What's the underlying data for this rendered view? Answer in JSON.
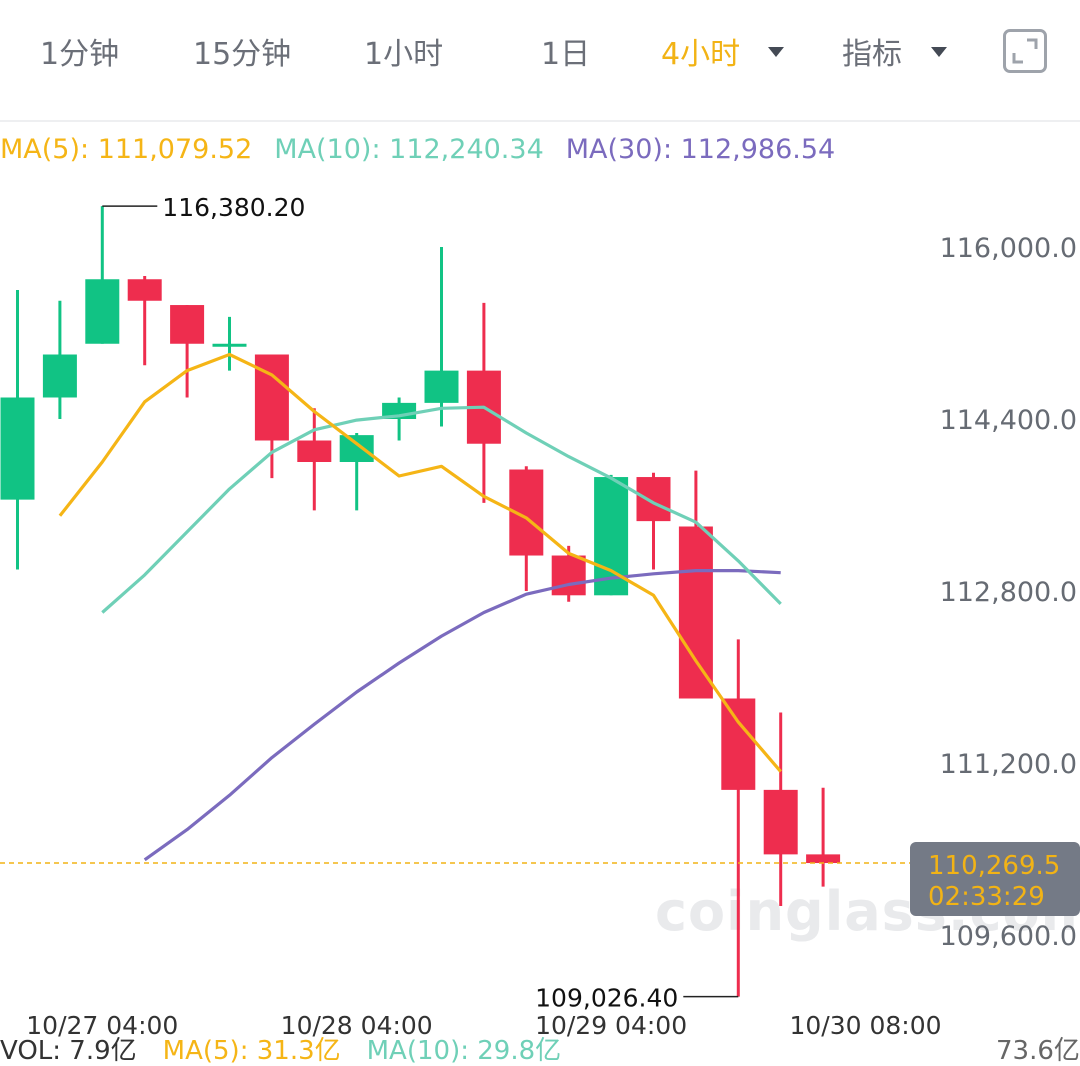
{
  "tabs": [
    {
      "label": "1分钟",
      "active": false
    },
    {
      "label": "15分钟",
      "active": false
    },
    {
      "label": "1小时",
      "active": false
    },
    {
      "label": "1日",
      "active": false
    },
    {
      "label": "4小时",
      "active": true
    },
    {
      "label": "指标",
      "active": false
    }
  ],
  "icons": {
    "fullscreen": "fullscreen-icon",
    "dropdown": "caret-down-icon"
  },
  "ma_legend": {
    "ma5": "MA(5): 111,079.52",
    "ma10": "MA(10): 112,240.34",
    "ma30": "MA(30): 112,986.54"
  },
  "colors": {
    "up": "#11c384",
    "down": "#ee2d4e",
    "ma5": "#f5b516",
    "ma10": "#6fd0b7",
    "ma30": "#7b6bbe",
    "accent": "#f2b315",
    "text": "#333333"
  },
  "current": {
    "price": "110,269.5",
    "countdown": "02:33:29"
  },
  "watermark": "coinglass.com",
  "volume_legend": {
    "vol": "VOL: 7.9亿",
    "ma5": "MA(5): 31.3亿",
    "ma10": "MA(10): 29.8亿",
    "right": "73.6亿"
  },
  "chart_data": {
    "type": "candlestick",
    "interval": "4小时",
    "ylim": [
      108800,
      116800
    ],
    "y_ticks": [
      116000,
      114400,
      112800,
      111200,
      109600
    ],
    "y_tick_labels": [
      "116,000.0",
      "114,400.0",
      "112,800.0",
      "111,200.0",
      "109,600.0"
    ],
    "x_tick_labels": [
      {
        "index": 2,
        "label": "10/27 04:00"
      },
      {
        "index": 8,
        "label": "10/28 04:00"
      },
      {
        "index": 14,
        "label": "10/29 04:00"
      },
      {
        "index": 20,
        "label": "10/30 08:00"
      }
    ],
    "candles": [
      {
        "o": 113650,
        "h": 115600,
        "l": 113000,
        "c": 114600
      },
      {
        "o": 114600,
        "h": 115500,
        "l": 114400,
        "c": 115000
      },
      {
        "o": 115100,
        "h": 116380.2,
        "l": 115100,
        "c": 115700
      },
      {
        "o": 115700,
        "h": 115730,
        "l": 114900,
        "c": 115500
      },
      {
        "o": 115460,
        "h": 115460,
        "l": 114600,
        "c": 115100
      },
      {
        "o": 115100,
        "h": 115350,
        "l": 114850,
        "c": 115100
      },
      {
        "o": 115000,
        "h": 115000,
        "l": 113850,
        "c": 114200
      },
      {
        "o": 114200,
        "h": 114500,
        "l": 113550,
        "c": 114000
      },
      {
        "o": 114000,
        "h": 114270,
        "l": 113550,
        "c": 114250
      },
      {
        "o": 114400,
        "h": 114600,
        "l": 114200,
        "c": 114550
      },
      {
        "o": 114550,
        "h": 116000,
        "l": 114330,
        "c": 114850
      },
      {
        "o": 114850,
        "h": 115480,
        "l": 113620,
        "c": 114170
      },
      {
        "o": 113930,
        "h": 113960,
        "l": 112800,
        "c": 113130
      },
      {
        "o": 113130,
        "h": 113220,
        "l": 112700,
        "c": 112760
      },
      {
        "o": 112760,
        "h": 113880,
        "l": 112760,
        "c": 113860
      },
      {
        "o": 113860,
        "h": 113900,
        "l": 113000,
        "c": 113450
      },
      {
        "o": 113400,
        "h": 113920,
        "l": 111840,
        "c": 111800
      },
      {
        "o": 111800,
        "h": 112350,
        "l": 109026.4,
        "c": 110950
      },
      {
        "o": 110950,
        "h": 111670,
        "l": 109870,
        "c": 110350
      },
      {
        "o": 110350,
        "h": 110970,
        "l": 110050,
        "c": 110269.5
      }
    ],
    "ma5": [
      null,
      113500,
      114000,
      114560,
      114850,
      115000,
      114810,
      114470,
      114170,
      113870,
      113960,
      113680,
      113480,
      113150,
      112990,
      112760,
      112150,
      111580,
      111120
    ],
    "ma10": [
      112600,
      112950,
      113350,
      113750,
      114090,
      114300,
      114390,
      114430,
      114500,
      114510,
      114270,
      114050,
      113850,
      113620,
      113440,
      113080,
      112680
    ],
    "ma30": [
      110300,
      110580,
      110900,
      111250,
      111560,
      111860,
      112130,
      112380,
      112600,
      112770,
      112860,
      112920,
      112960,
      112990,
      112990,
      112970
    ],
    "ma10_start_index": 2,
    "ma30_start_index": 3,
    "annotations": [
      {
        "label": "116,380.20",
        "value": 116380.2,
        "index": 2
      },
      {
        "label": "109,026.40",
        "value": 109026.4,
        "index": 17
      }
    ],
    "current_price": 110269.5,
    "grid": false
  }
}
